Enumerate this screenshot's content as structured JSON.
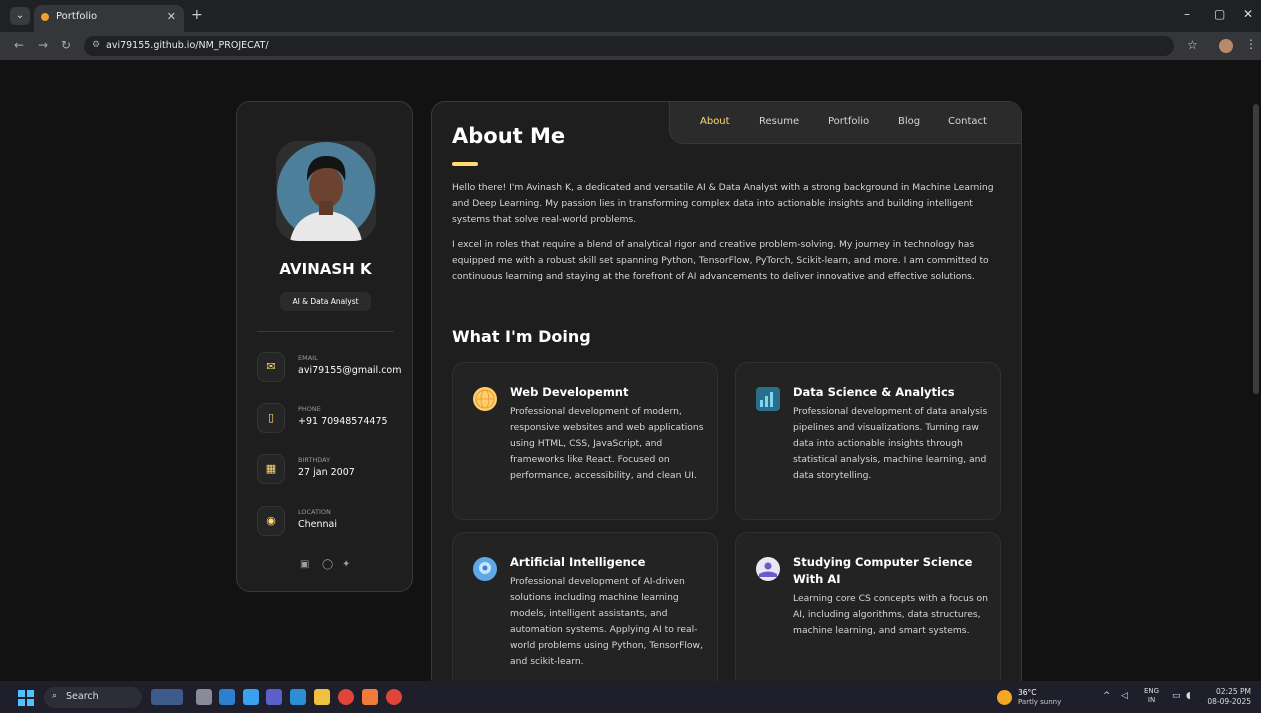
{
  "browser": {
    "tab_title": "Portfolio",
    "url": "avi79155.github.io/NM_PROJECAT/"
  },
  "sidebar": {
    "name": "AVINASH K",
    "role": "AI & Data Analyst",
    "contacts": [
      {
        "label": "EMAIL",
        "value": "avi79155@gmail.com",
        "icon": "mail-icon"
      },
      {
        "label": "PHONE",
        "value": "+91 70948574475",
        "icon": "phone-icon"
      },
      {
        "label": "BIRTHDAY",
        "value": "27 jan 2007",
        "icon": "calendar-icon"
      },
      {
        "label": "LOCATION",
        "value": "Chennai",
        "icon": "location-pin-icon"
      }
    ],
    "socials": [
      "linkedin-icon",
      "github-icon",
      "twitter-icon"
    ]
  },
  "nav": {
    "items": [
      "About",
      "Resume",
      "Portfolio",
      "Blog",
      "Contact"
    ],
    "active": "About",
    "accent": "#ffdb70"
  },
  "about": {
    "heading": "About Me",
    "p1": "Hello there! I'm Avinash K, a dedicated and versatile AI & Data Analyst with a strong background in Machine Learning and Deep Learning. My passion lies in transforming complex data into actionable insights and building intelligent systems that solve real-world problems.",
    "p2": "I excel in roles that require a blend of analytical rigor and creative problem-solving. My journey in technology has equipped me with a robust skill set spanning Python, TensorFlow, PyTorch, Scikit-learn, and more. I am committed to continuous learning and staying at the forefront of AI advancements to deliver innovative and effective solutions."
  },
  "doing": {
    "heading": "What I'm Doing",
    "services": [
      {
        "title": "Web Developemnt",
        "text": "Professional development of modern, responsive websites and web applications using HTML, CSS, JavaScript, and frameworks like React. Focused on performance, accessibility, and clean UI.",
        "icon": "globe-icon"
      },
      {
        "title": "Data Science & Analytics",
        "text": "Professional development of data analysis pipelines and visualizations. Turning raw data into actionable insights through statistical analysis, machine learning, and data storytelling.",
        "icon": "analytics-icon"
      },
      {
        "title": "Artificial Intelligence",
        "text": "Professional development of AI-driven solutions including machine learning models, intelligent assistants, and automation systems. Applying AI to real-world problems using Python, TensorFlow, and scikit-learn.",
        "icon": "ai-brain-icon"
      },
      {
        "title": "Studying Computer Science With AI",
        "text": "Learning core CS concepts with a focus on AI, including algorithms, data structures, machine learning, and smart systems.",
        "icon": "study-icon"
      }
    ]
  },
  "taskbar": {
    "search_placeholder": "Search",
    "weather_temp": "36°C",
    "weather_cond": "Partly sunny",
    "lang_top": "ENG",
    "lang_bottom": "IN",
    "time": "02:25 PM",
    "date": "08-09-2025"
  }
}
